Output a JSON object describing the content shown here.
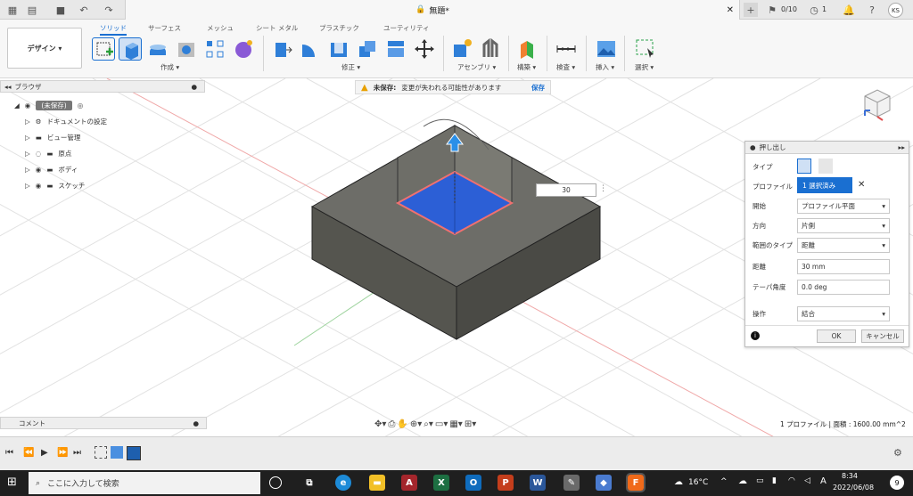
{
  "window": {
    "title": "無題*",
    "job_status": "0/10",
    "notif_count": "1",
    "user_initials": "KS"
  },
  "ribbon": {
    "tabs": [
      "ソリッド",
      "サーフェス",
      "メッシュ",
      "シート メタル",
      "プラスチック",
      "ユーティリティ"
    ],
    "design_label": "デザイン",
    "groups": [
      "作成",
      "修正",
      "アセンブリ",
      "構築",
      "検査",
      "挿入",
      "選択"
    ]
  },
  "browser": {
    "title": "ブラウザ",
    "items": [
      "(未保存)",
      "ドキュメントの設定",
      "ビュー管理",
      "原点",
      "ボディ",
      "スケッチ"
    ]
  },
  "warning": {
    "label": "未保存:",
    "message": "変更が失われる可能性があります",
    "action": "保存"
  },
  "dimension_input": "30",
  "panel": {
    "title": "押し出し",
    "rows": [
      {
        "label": "タイプ",
        "value": ""
      },
      {
        "label": "プロファイル",
        "value": "1 選択済み"
      },
      {
        "label": "開始",
        "value": "プロファイル平面"
      },
      {
        "label": "方向",
        "value": "片側"
      },
      {
        "label": "範囲のタイプ",
        "value": "距離"
      },
      {
        "label": "距離",
        "value": "30 mm"
      },
      {
        "label": "テーパ角度",
        "value": "0.0 deg"
      },
      {
        "label": "操作",
        "value": "結合"
      }
    ],
    "ok": "OK",
    "cancel": "キャンセル"
  },
  "comment_label": "コメント",
  "status": "1 プロファイル | 面積 : 1600.00 mm^2",
  "taskbar": {
    "search_placeholder": "ここに入力して検索",
    "temperature": "16°C",
    "ime": "A",
    "time": "8:34",
    "date": "2022/06/08",
    "badge": "9"
  },
  "colors": {
    "accent": "#1a6fd1",
    "body": "#5e5e5a",
    "profile": "#2c5fd6",
    "profile_edge": "#f07070"
  }
}
